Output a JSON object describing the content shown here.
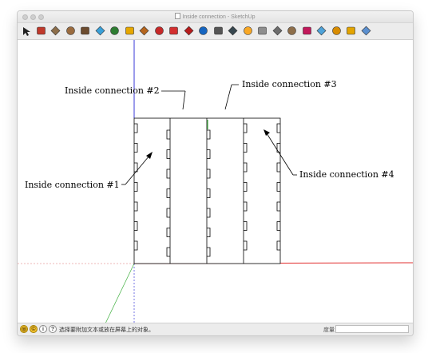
{
  "window": {
    "title": "Inside connection - SketchUp"
  },
  "toolbar": {
    "tools": [
      {
        "name": "select-tool",
        "color": "#333333"
      },
      {
        "name": "pencil-tool",
        "color": "#c0392b"
      },
      {
        "name": "rectangle-tool",
        "color": "#8d6e4a"
      },
      {
        "name": "circle-tool",
        "color": "#9a6b3f"
      },
      {
        "name": "arc-tool",
        "color": "#6d4c2f"
      },
      {
        "name": "push-pull-tool",
        "color": "#3aa0d8"
      },
      {
        "name": "offset-tool",
        "color": "#2e7d32"
      },
      {
        "name": "follow-me-tool",
        "color": "#e6a700"
      },
      {
        "name": "paint-bucket-tool",
        "color": "#b5651d"
      },
      {
        "name": "move-tool",
        "color": "#c62828"
      },
      {
        "name": "rotate-tool",
        "color": "#d32f2f"
      },
      {
        "name": "scale-tool",
        "color": "#b71c1c"
      },
      {
        "name": "orbit-tool",
        "color": "#1565c0"
      },
      {
        "name": "pan-tool",
        "color": "#555555"
      },
      {
        "name": "zoom-tool",
        "color": "#37474f"
      },
      {
        "name": "zoom-extents-tool",
        "color": "#f9a825"
      },
      {
        "name": "section-plane-tool",
        "color": "#8e8e8e"
      },
      {
        "name": "text-tool",
        "color": "#6d6d6d"
      },
      {
        "name": "dimension-tool",
        "color": "#8d6e4a"
      },
      {
        "name": "walk-tool",
        "color": "#c2185b"
      },
      {
        "name": "look-around-tool",
        "color": "#4fa3d9"
      },
      {
        "name": "position-camera-tool",
        "color": "#d88c00"
      },
      {
        "name": "components-tool",
        "color": "#e3a400"
      },
      {
        "name": "materials-tool",
        "color": "#5b8fcf"
      }
    ]
  },
  "canvas": {
    "labels": {
      "inside1": "Inside connection #1",
      "inside2": "Inside connection #2",
      "inside3": "Inside connection #3",
      "inside4": "Inside connection #4"
    },
    "axis_colors": {
      "blue": "#3a3ad8",
      "red": "#e23030",
      "green": "#41b041"
    }
  },
  "statusbar": {
    "hint": "选择要附加文本或放在屏幕上的对象。",
    "measurements_label": "度量",
    "measurements_value": ""
  }
}
